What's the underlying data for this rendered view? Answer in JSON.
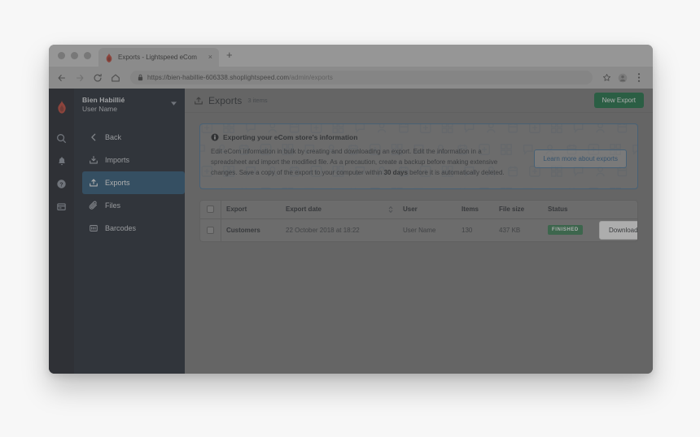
{
  "browser": {
    "tab": {
      "title": "Exports - Lightspeed eCom",
      "close_label": "×",
      "favicon": "lightspeed-flame-icon"
    },
    "new_tab_label": "+",
    "omnibox": {
      "url_secure": "https://bien-habillie-606338.shoplightspeed.com",
      "url_path": "/admin/exports",
      "lock_icon": "lock-icon"
    },
    "nav": {
      "back_icon": "arrow-left-icon",
      "forward_icon": "arrow-right-icon",
      "reload_icon": "reload-icon",
      "home_icon": "home-icon"
    },
    "actions": {
      "bookmark_icon": "star-icon",
      "profile_icon": "account-avatar-icon",
      "menu_icon": "three-dot-menu-icon"
    }
  },
  "app": {
    "rail": [
      {
        "name": "search-icon"
      },
      {
        "name": "notifications-bell-icon"
      },
      {
        "name": "help-circle-icon"
      },
      {
        "name": "store-card-icon"
      }
    ],
    "account": {
      "shop": "Bien Habillié",
      "user": "User Name",
      "caret": "▼"
    },
    "nav": [
      {
        "label": "Back",
        "icon": "chevron-left-icon",
        "active": false
      },
      {
        "label": "Imports",
        "icon": "import-icon",
        "active": false
      },
      {
        "label": "Exports",
        "icon": "export-icon",
        "active": true
      },
      {
        "label": "Files",
        "icon": "paperclip-icon",
        "active": false
      },
      {
        "label": "Barcodes",
        "icon": "barcode-icon",
        "active": false
      }
    ]
  },
  "header": {
    "icon": "export-icon",
    "title": "Exports",
    "count": "3 items",
    "new_export_label": "New Export"
  },
  "banner": {
    "info_icon": "info-circle-icon",
    "heading": "Exporting your eCom store's information",
    "body_part_1": "Edit eCom information in bulk by creating and downloading an export. Edit the information in a spreadsheet and import the modified file. As a precaution, create a backup before making extensive changes. Save a copy of the export to your computer within ",
    "body_bold": "30 days",
    "body_part_2": " before it is automatically deleted.",
    "learn_more_label": "Learn more about exports"
  },
  "table": {
    "columns": [
      "Export",
      "Export date",
      "User",
      "Items",
      "File size",
      "Status"
    ],
    "sort_icon": "sort-updown-icon",
    "rows": [
      {
        "export": "Customers",
        "date": "22 October 2018 at 18:22",
        "user": "User Name",
        "items": "130",
        "file_size": "437 KB",
        "status": "FINISHED",
        "action": "Download"
      }
    ]
  },
  "colors": {
    "brand_red": "#c0392b",
    "accent_blue": "#1d4e72",
    "success_green": "#0b6b39",
    "badge_green": "#2c7a4b",
    "sidebar_dark": "#161d28",
    "rail_dark": "#11161f"
  }
}
